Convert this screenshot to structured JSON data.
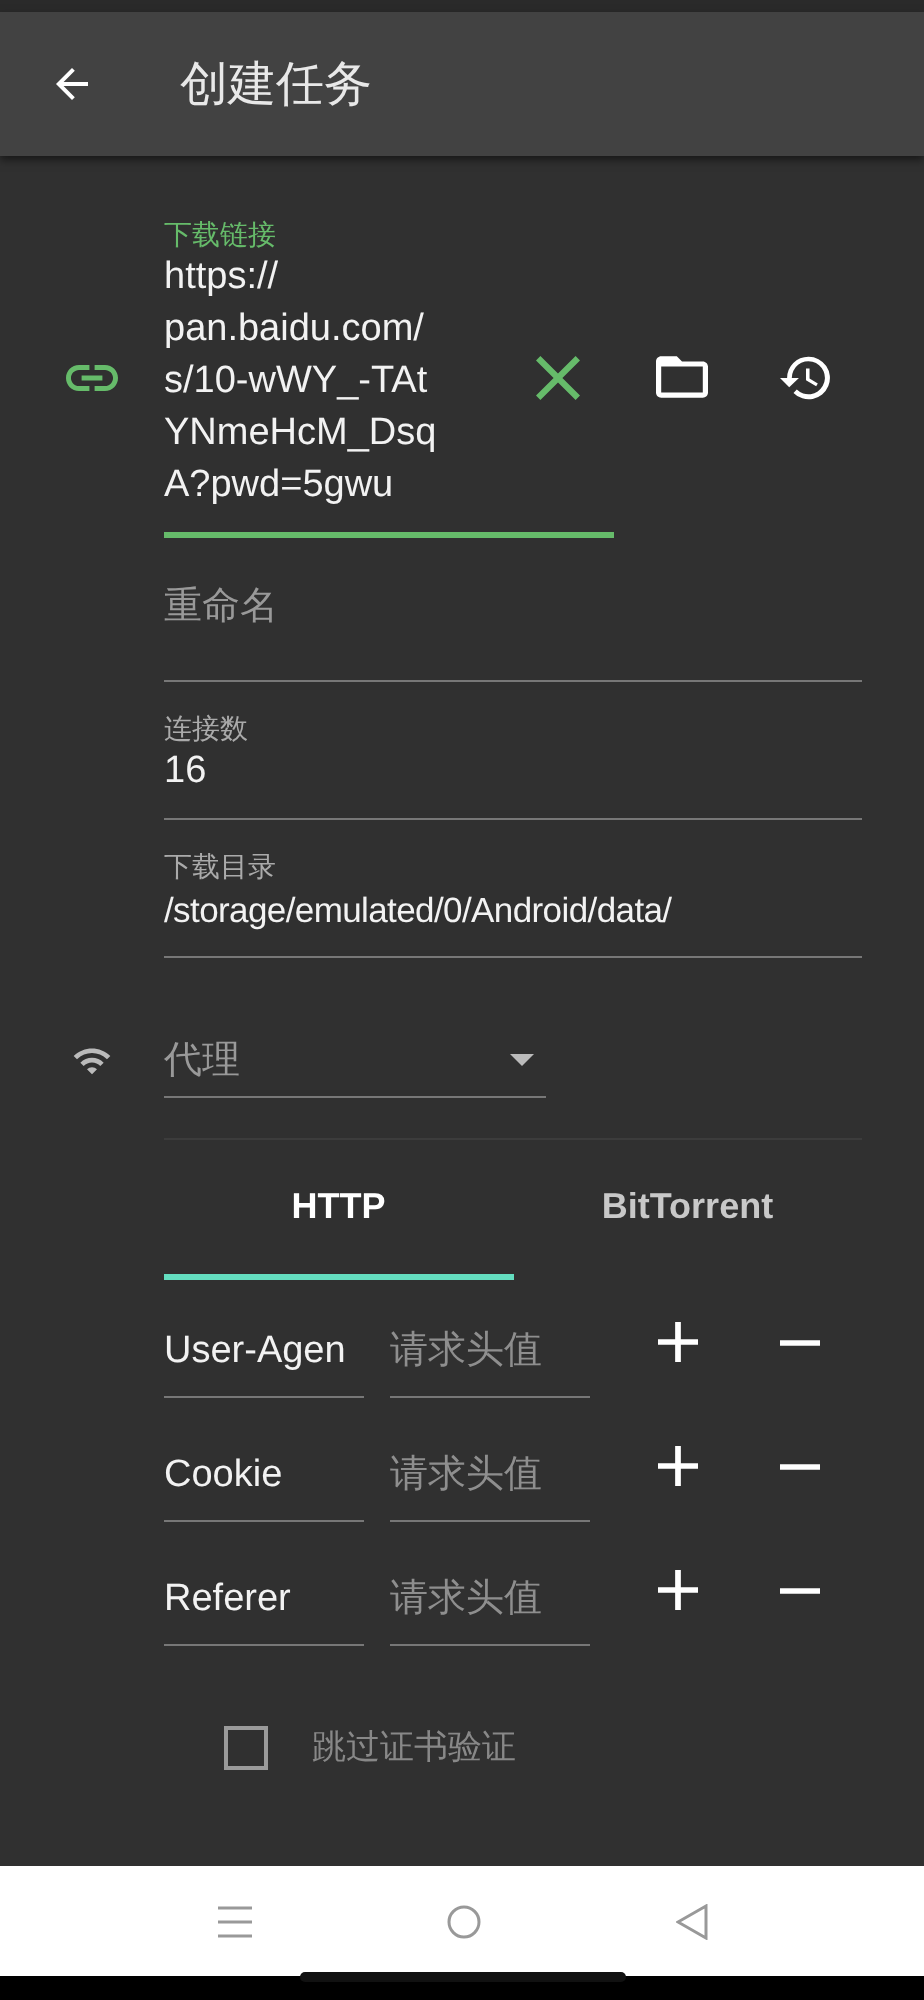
{
  "app_bar": {
    "title": "创建任务"
  },
  "link_field": {
    "label": "下载链接",
    "value": "https://\npan.baidu.com/\ns/10-wWY_-TAt\nYNmeHcM_Dsq\nA?pwd=5gwu",
    "focused": true
  },
  "rename_field": {
    "placeholder": "重命名"
  },
  "connections_field": {
    "label": "连接数",
    "value": "16"
  },
  "directory_field": {
    "label": "下载目录",
    "value": "/storage/emulated/0/Android/data/"
  },
  "proxy_dropdown": {
    "placeholder": "代理"
  },
  "tabs": [
    {
      "label": "HTTP",
      "selected": true
    },
    {
      "label": "BitTorrent",
      "selected": false
    }
  ],
  "headers": [
    {
      "name": "User-Agen",
      "placeholder": "请求头值"
    },
    {
      "name": "Cookie",
      "placeholder": "请求头值"
    },
    {
      "name": "Referer",
      "placeholder": "请求头值"
    }
  ],
  "skip_cert_check": {
    "label": "跳过证书验证",
    "checked": false
  }
}
